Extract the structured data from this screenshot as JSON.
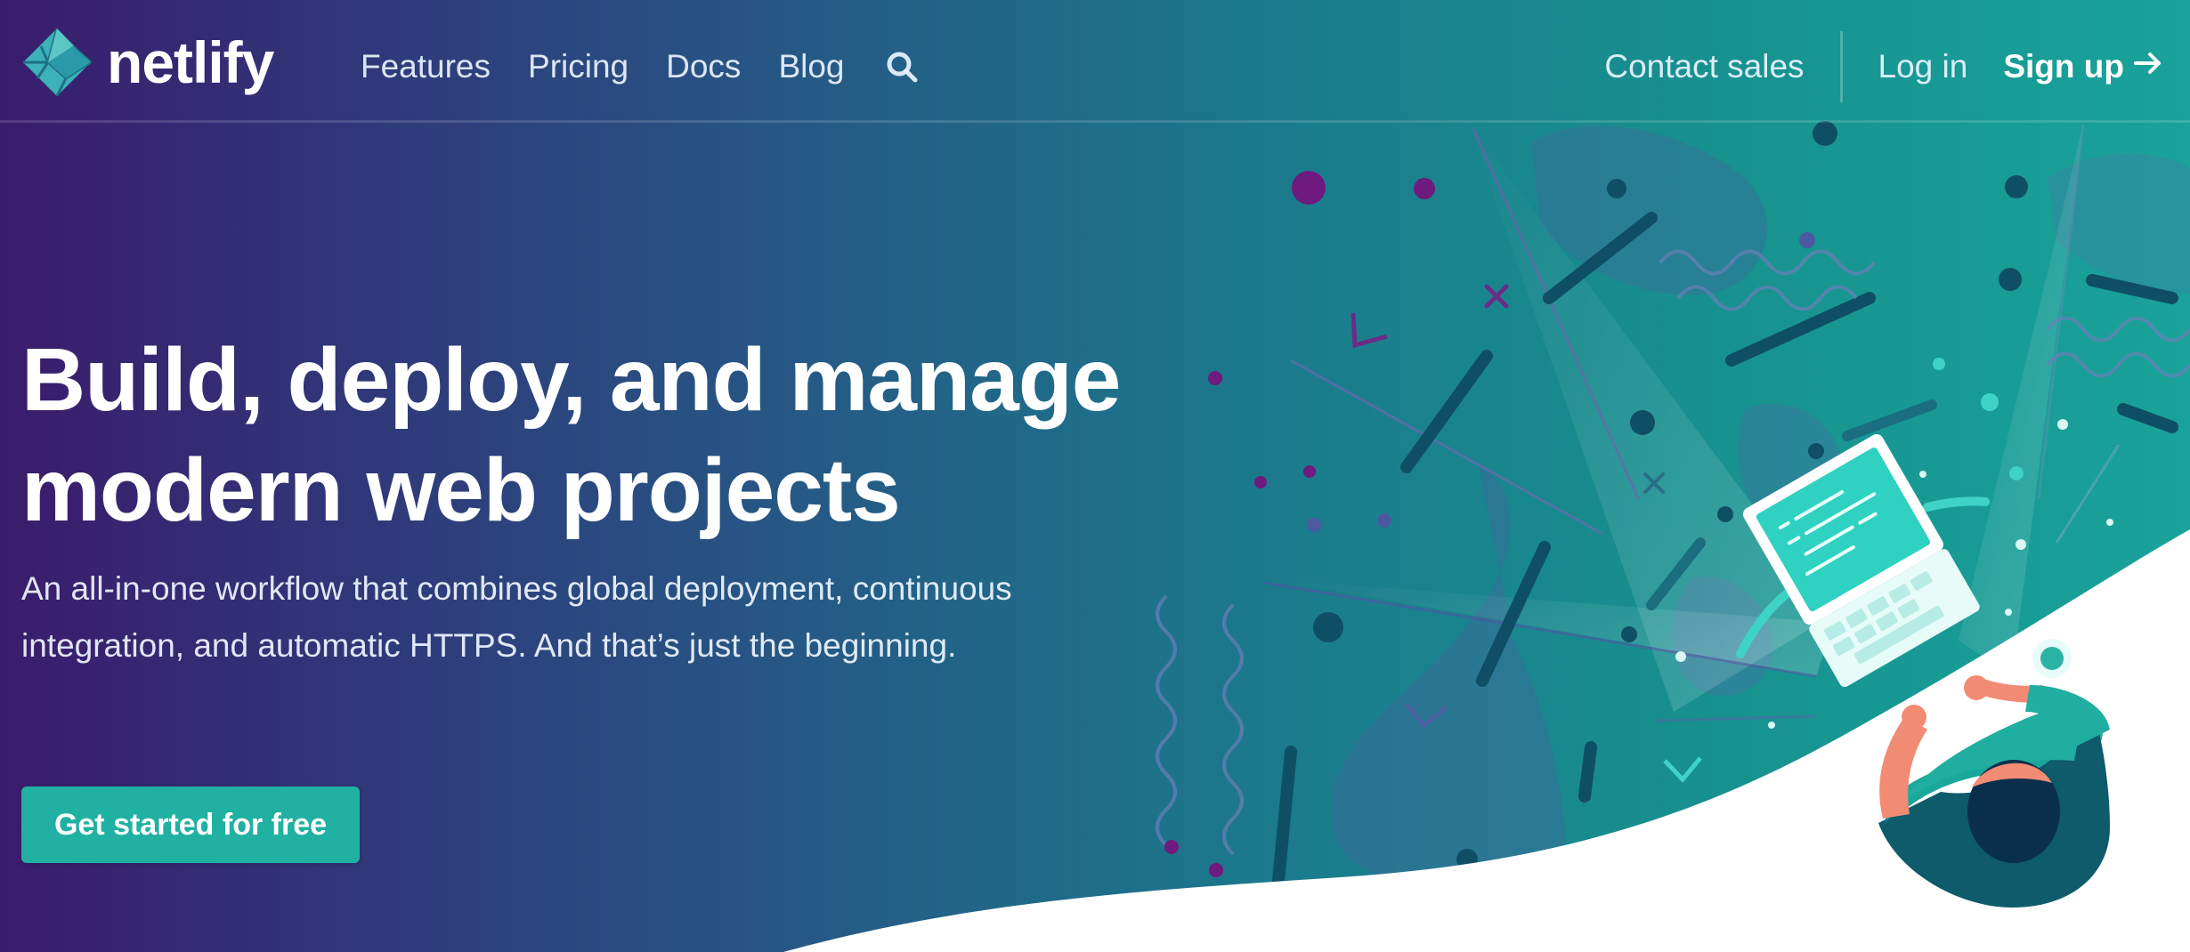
{
  "brand": {
    "name": "netlify",
    "logo_icon": "netlify-diamond-logo-icon"
  },
  "nav": {
    "links": [
      "Features",
      "Pricing",
      "Docs",
      "Blog"
    ],
    "search_icon": "search-icon",
    "contact_sales": "Contact sales",
    "log_in": "Log in",
    "sign_up": "Sign up",
    "sign_up_icon": "arrow-right-icon"
  },
  "hero": {
    "title_line1": "Build, deploy, and manage",
    "title_line2": "modern web projects",
    "subtitle": "An all-in-one workflow that combines global deployment, continuous integration, and automatic HTTPS. And that’s just the beginning.",
    "cta_label": "Get started for free"
  },
  "colors": {
    "gradient_start": "#3a1c6c",
    "gradient_end": "#19a39a",
    "accent": "#20b1a2",
    "text": "#ffffff"
  }
}
